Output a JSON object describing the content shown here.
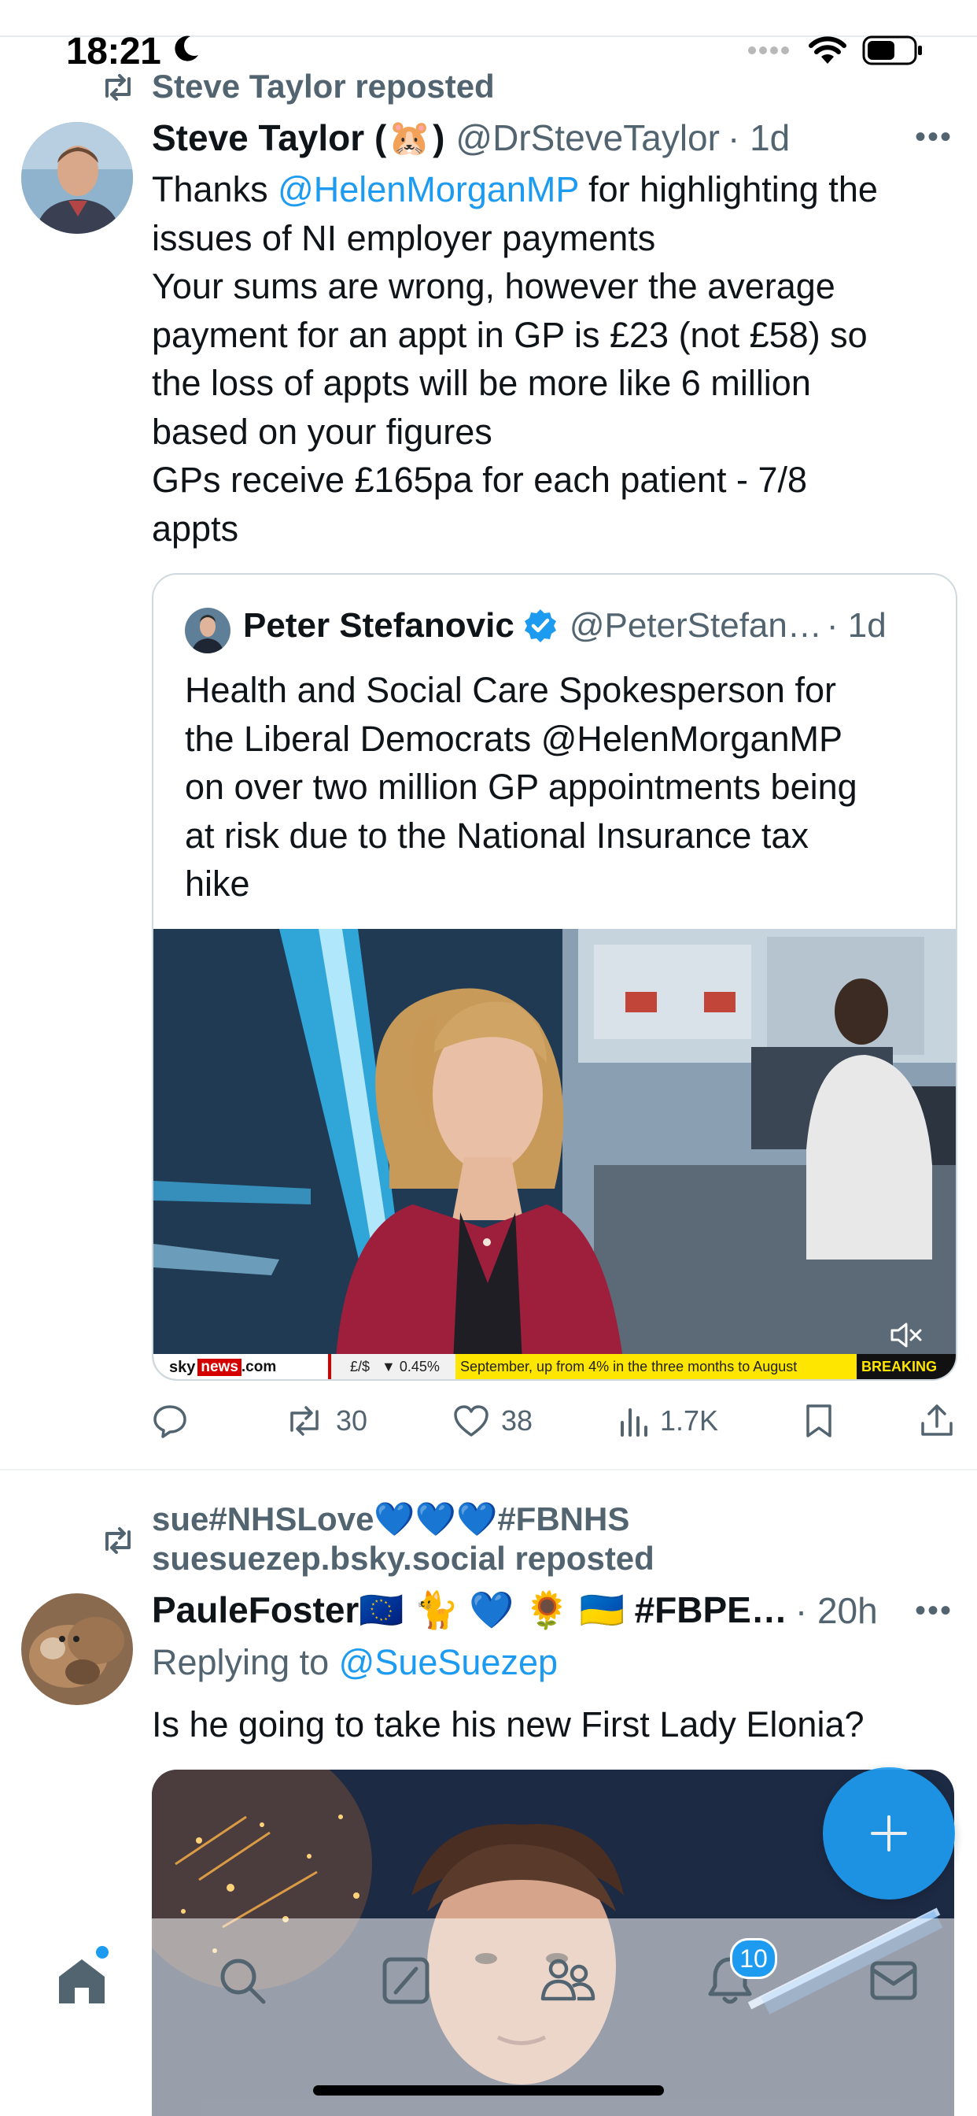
{
  "status_bar": {
    "time": "18:21"
  },
  "tweet1": {
    "repost_label": "Steve Taylor reposted",
    "author_name": "Steve Taylor (",
    "author_name_suffix": ")",
    "author_emoji": "🐹",
    "handle": "@DrSteveTaylor",
    "time": "· 1d",
    "body_lines": [
      {
        "pre": "Thanks ",
        "mention": "@HelenMorganMP",
        "post": " for highlighting the"
      },
      "issues of NI employer payments",
      "Your sums are wrong, however the average",
      "payment for an appt in GP is £23 (not £58) so",
      "the loss of appts will be more like 6 million",
      "based on your figures",
      "GPs receive £165pa for each patient - 7/8",
      "appts"
    ],
    "quote": {
      "name": "Peter Stefanovic",
      "handle": "@PeterStefan…",
      "time": "· 1d",
      "text_lines": [
        "Health and Social Care Spokesperson for",
        "the Liberal Democrats @HelenMorganMP",
        "on over two million GP appointments being",
        "at risk due to the National Insurance tax",
        "hike"
      ],
      "ticker": {
        "sky": "sky",
        "news": "news",
        "dotcom": ".com",
        "currency": "£/$",
        "change": "▼ 0.45%",
        "headline": "September, up from 4% in the three months to August",
        "breaking": "BREAKING"
      }
    },
    "stats": {
      "replies": "",
      "reposts": "30",
      "likes": "38",
      "views": "1.7K"
    }
  },
  "tweet2": {
    "repost_label_line1": "sue#NHSLove💙💙💙#FBNHS",
    "repost_label_line2": "suesuezep.bsky.social reposted",
    "author_name": "PauleFoster🇪🇺 🐈 💙 🌻 🇺🇦 #FBPE…",
    "time": "· 20h",
    "replying_prefix": "Replying to ",
    "replying_handle": "@SueSuezep",
    "body": "Is he going to take his new First Lady Elonia?"
  },
  "nav": {
    "notifications_badge": "10"
  },
  "colors": {
    "accent": "#1d9bf0",
    "muted": "#536471",
    "text": "#0f1419"
  }
}
